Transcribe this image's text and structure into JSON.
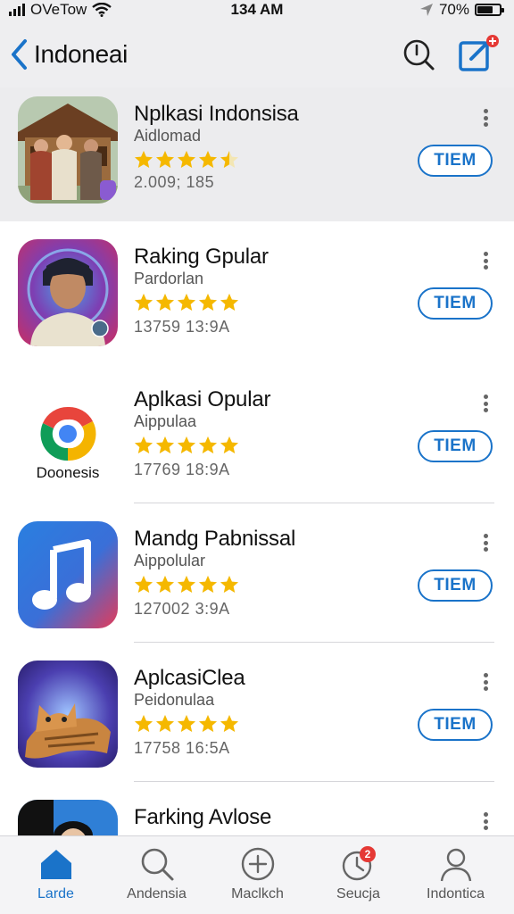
{
  "status_bar": {
    "carrier": "OVeTow",
    "time": "134 AM",
    "battery": "70%",
    "battery_level": 0.7
  },
  "nav": {
    "back_title": "Indoneai"
  },
  "colors": {
    "accent": "#1a73c9",
    "star": "#f5b800",
    "badge": "#e53935"
  },
  "apps": [
    {
      "name": "Nplkasi Indonsisa",
      "subtitle": "Aidlomad",
      "rating": 4.5,
      "meta": "2.009; 185",
      "button": "TIEM",
      "icon": "people-photo-icon"
    },
    {
      "name": "Raking Gpular",
      "subtitle": "Pardorlan",
      "rating": 5,
      "meta": "13759 13:9A",
      "button": "TIEM",
      "icon": "portrait-photo-icon"
    },
    {
      "name": "Aplkasi Opular",
      "subtitle": "Aippulaa",
      "rating": 5,
      "meta": "17769 18:9A",
      "button": "TIEM",
      "icon": "browser-logo-icon",
      "icon_text": "Doonesis"
    },
    {
      "name": "Mandg Pabnissal",
      "subtitle": "Aippolular",
      "rating": 5,
      "meta": "127002 3:9A",
      "button": "TIEM",
      "icon": "music-note-icon"
    },
    {
      "name": "AplcasiClea",
      "subtitle": "Peidonulaa",
      "rating": 5,
      "meta": "17758 16:5A",
      "button": "TIEM",
      "icon": "cat-photo-icon"
    },
    {
      "name": "Farking Avlose",
      "subtitle": "",
      "rating": 0,
      "meta": "",
      "button": "",
      "icon": "avatar-photo-icon"
    }
  ],
  "tabs": [
    {
      "label": "Larde",
      "icon": "home-icon",
      "active": true
    },
    {
      "label": "Andensia",
      "icon": "search-icon",
      "active": false
    },
    {
      "label": "Maclkch",
      "icon": "plus-circle-icon",
      "active": false
    },
    {
      "label": "Seucja",
      "icon": "clock-badge-icon",
      "active": false,
      "badge": "2"
    },
    {
      "label": "Indontica",
      "icon": "person-icon",
      "active": false
    }
  ]
}
